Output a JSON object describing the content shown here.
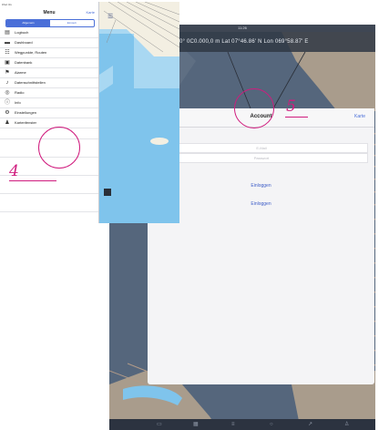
{
  "large_screen": {
    "status_time": "11:26",
    "coords_text": "00° 0C0.000,0 m  Lat 07°46.86' N  Lon 069°58.87' E",
    "modal": {
      "title": "Account",
      "close_label": "Karte",
      "email_placeholder": "E-Mail",
      "password_placeholder": "Passwort",
      "login_link": "Einloggen",
      "register_link": "Einloggen"
    },
    "tabbar_icons": [
      "menu-icon",
      "grid-icon",
      "layers-icon",
      "info-icon",
      "route-icon",
      "person-icon"
    ]
  },
  "small_screen": {
    "status_left": "iPad 4G",
    "status_time": "9:41",
    "menu": {
      "title": "Menu",
      "close_label": "Karte",
      "segments": [
        "Allgemein",
        "Einstell."
      ],
      "active_segment": 0,
      "items": [
        {
          "icon": "logbook-icon",
          "label": "Logbuch"
        },
        {
          "icon": "dashboard-icon",
          "label": "Dashboard"
        },
        {
          "icon": "waypoint-icon",
          "label": "Wegpunkte, Routen"
        },
        {
          "icon": "database-icon",
          "label": "Datenbank"
        },
        {
          "icon": "alarm-icon",
          "label": "Alarme"
        },
        {
          "icon": "sensor-icon",
          "label": "Datenschnittstellen"
        },
        {
          "icon": "radio-icon",
          "label": "Radio"
        },
        {
          "icon": "info-icon",
          "label": "Info"
        },
        {
          "icon": "settings-icon",
          "label": "Einstellungen"
        },
        {
          "icon": "account-icon",
          "label": "Kartenfenster"
        }
      ]
    },
    "header_hint": "iNavX"
  },
  "annotations": {
    "step_left": "4",
    "step_right": "5",
    "accent_color": "#d01c7e"
  },
  "colors": {
    "water_light": "#7fc4ec",
    "water_dark": "#54657a",
    "land": "#f3efe2",
    "link_blue": "#3f5ec8"
  }
}
